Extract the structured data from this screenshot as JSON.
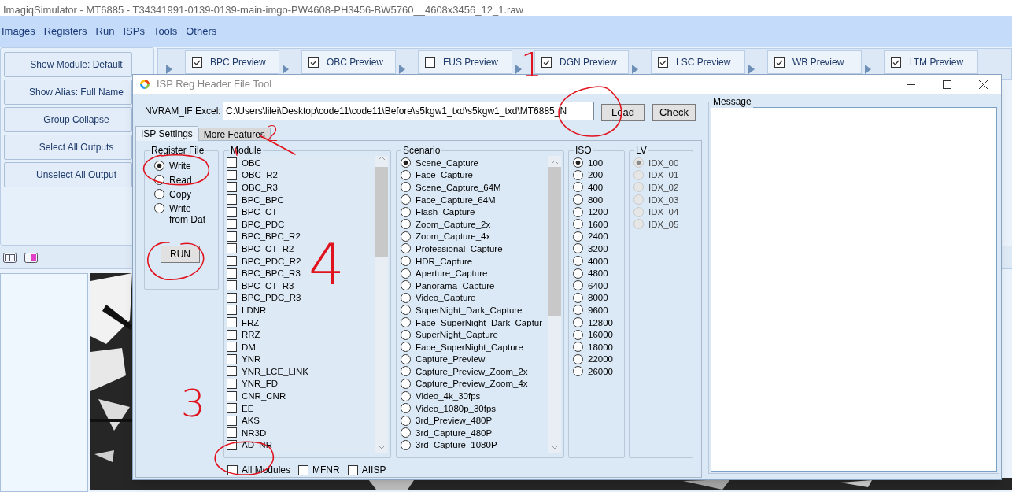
{
  "app": {
    "title": "ImagiqSimulator - MT6885 - T34341991-0139-0139-main-imgo-PW4608-PH3456-BW5760__4608x3456_12_1.raw",
    "menu": [
      "Images",
      "Registers",
      "Run",
      "ISPs",
      "Tools",
      "Others"
    ],
    "side_buttons": [
      "Show Module: Default",
      "Show Alias: Full Name",
      "Group Collapse",
      "Select All Outputs",
      "Unselect All Output"
    ],
    "preview_tabs": [
      {
        "label": "BPC Preview",
        "checked": true
      },
      {
        "label": "OBC Preview",
        "checked": true
      },
      {
        "label": "FUS Preview",
        "checked": false
      },
      {
        "label": "DGN Preview",
        "checked": true
      },
      {
        "label": "LSC Preview",
        "checked": true
      },
      {
        "label": "WB Preview",
        "checked": true
      },
      {
        "label": "LTM Preview",
        "checked": true
      }
    ],
    "image": {
      "kind": "picture"
    }
  },
  "dialog": {
    "title": "ISP Reg Header File Tool",
    "excel_label": "NVRAM_IF Excel:",
    "excel_path": "C:\\Users\\lilei\\Desktop\\code11\\code11\\Before\\s5kgw1_txd\\s5kgw1_txd\\MT6885_N",
    "buttons": [
      "Load",
      "Check"
    ],
    "message_label": "Message",
    "tabs": [
      {
        "label": "ISP Settings",
        "selected": true
      },
      {
        "label": "More Features",
        "selected": false
      }
    ],
    "register_file": {
      "title": "Register File",
      "run": "RUN",
      "options": [
        {
          "label": "Write",
          "selected": true
        },
        {
          "label": "Read",
          "selected": false
        },
        {
          "label": "Copy",
          "selected": false
        },
        {
          "label": "Write from Dat",
          "selected": false
        }
      ]
    },
    "module": {
      "title": "Module",
      "items": [
        {
          "label": "OBC",
          "checked": false
        },
        {
          "label": "OBC_R2",
          "checked": false
        },
        {
          "label": "OBC_R3",
          "checked": false
        },
        {
          "label": "BPC_BPC",
          "checked": false
        },
        {
          "label": "BPC_CT",
          "checked": false
        },
        {
          "label": "BPC_PDC",
          "checked": false
        },
        {
          "label": "BPC_BPC_R2",
          "checked": false
        },
        {
          "label": "BPC_CT_R2",
          "checked": false
        },
        {
          "label": "BPC_PDC_R2",
          "checked": false
        },
        {
          "label": "BPC_BPC_R3",
          "checked": false
        },
        {
          "label": "BPC_CT_R3",
          "checked": false
        },
        {
          "label": "BPC_PDC_R3",
          "checked": false
        },
        {
          "label": "LDNR",
          "checked": false
        },
        {
          "label": "FRZ",
          "checked": false
        },
        {
          "label": "RRZ",
          "checked": false
        },
        {
          "label": "DM",
          "checked": false
        },
        {
          "label": "YNR",
          "checked": false
        },
        {
          "label": "YNR_LCE_LINK",
          "checked": false
        },
        {
          "label": "YNR_FD",
          "checked": false
        },
        {
          "label": "CNR_CNR",
          "checked": false
        },
        {
          "label": "EE",
          "checked": false
        },
        {
          "label": "AKS",
          "checked": false
        },
        {
          "label": "NR3D",
          "checked": false
        },
        {
          "label": "AD_NR",
          "checked": false
        }
      ]
    },
    "module_options": [
      {
        "label": "All Modules",
        "checked": false
      },
      {
        "label": "MFNR",
        "checked": false
      },
      {
        "label": "AIISP",
        "checked": false
      }
    ],
    "scenario": {
      "title": "Scenario",
      "items": [
        {
          "label": "Scene_Capture",
          "selected": true
        },
        {
          "label": "Face_Capture",
          "selected": false
        },
        {
          "label": "Scene_Capture_64M",
          "selected": false
        },
        {
          "label": "Face_Capture_64M",
          "selected": false
        },
        {
          "label": "Flash_Capture",
          "selected": false
        },
        {
          "label": "Zoom_Capture_2x",
          "selected": false
        },
        {
          "label": "Zoom_Capture_4x",
          "selected": false
        },
        {
          "label": "Professional_Capture",
          "selected": false
        },
        {
          "label": "HDR_Capture",
          "selected": false
        },
        {
          "label": "Aperture_Capture",
          "selected": false
        },
        {
          "label": "Panorama_Capture",
          "selected": false
        },
        {
          "label": "Video_Capture",
          "selected": false
        },
        {
          "label": "SuperNight_Dark_Capture",
          "selected": false
        },
        {
          "label": "Face_SuperNight_Dark_Captur",
          "selected": false
        },
        {
          "label": "SuperNight_Capture",
          "selected": false
        },
        {
          "label": "Face_SuperNight_Capture",
          "selected": false
        },
        {
          "label": "Capture_Preview",
          "selected": false
        },
        {
          "label": "Capture_Preview_Zoom_2x",
          "selected": false
        },
        {
          "label": "Capture_Preview_Zoom_4x",
          "selected": false
        },
        {
          "label": "Video_4k_30fps",
          "selected": false
        },
        {
          "label": "Video_1080p_30fps",
          "selected": false
        },
        {
          "label": "3rd_Preview_480P",
          "selected": false
        },
        {
          "label": "3rd_Capture_480P",
          "selected": false
        },
        {
          "label": "3rd_Capture_1080P",
          "selected": false
        }
      ]
    },
    "iso": {
      "title": "ISO",
      "disabled": false,
      "items": [
        {
          "label": "100",
          "selected": true
        },
        {
          "label": "200",
          "selected": false
        },
        {
          "label": "400",
          "selected": false
        },
        {
          "label": "800",
          "selected": false
        },
        {
          "label": "1200",
          "selected": false
        },
        {
          "label": "1600",
          "selected": false
        },
        {
          "label": "2400",
          "selected": false
        },
        {
          "label": "3200",
          "selected": false
        },
        {
          "label": "4000",
          "selected": false
        },
        {
          "label": "4800",
          "selected": false
        },
        {
          "label": "6400",
          "selected": false
        },
        {
          "label": "8000",
          "selected": false
        },
        {
          "label": "9600",
          "selected": false
        },
        {
          "label": "12800",
          "selected": false
        },
        {
          "label": "16000",
          "selected": false
        },
        {
          "label": "18000",
          "selected": false
        },
        {
          "label": "22000",
          "selected": false
        },
        {
          "label": "26000",
          "selected": false
        }
      ]
    },
    "lv": {
      "title": "LV",
      "disabled": true,
      "items": [
        {
          "label": "IDX_00",
          "selected": true
        },
        {
          "label": "IDX_01",
          "selected": false
        },
        {
          "label": "IDX_02",
          "selected": false
        },
        {
          "label": "IDX_03",
          "selected": false
        },
        {
          "label": "IDX_04",
          "selected": false
        },
        {
          "label": "IDX_05",
          "selected": false
        }
      ]
    }
  },
  "annotations": [
    "1",
    "2",
    "3",
    "4"
  ]
}
